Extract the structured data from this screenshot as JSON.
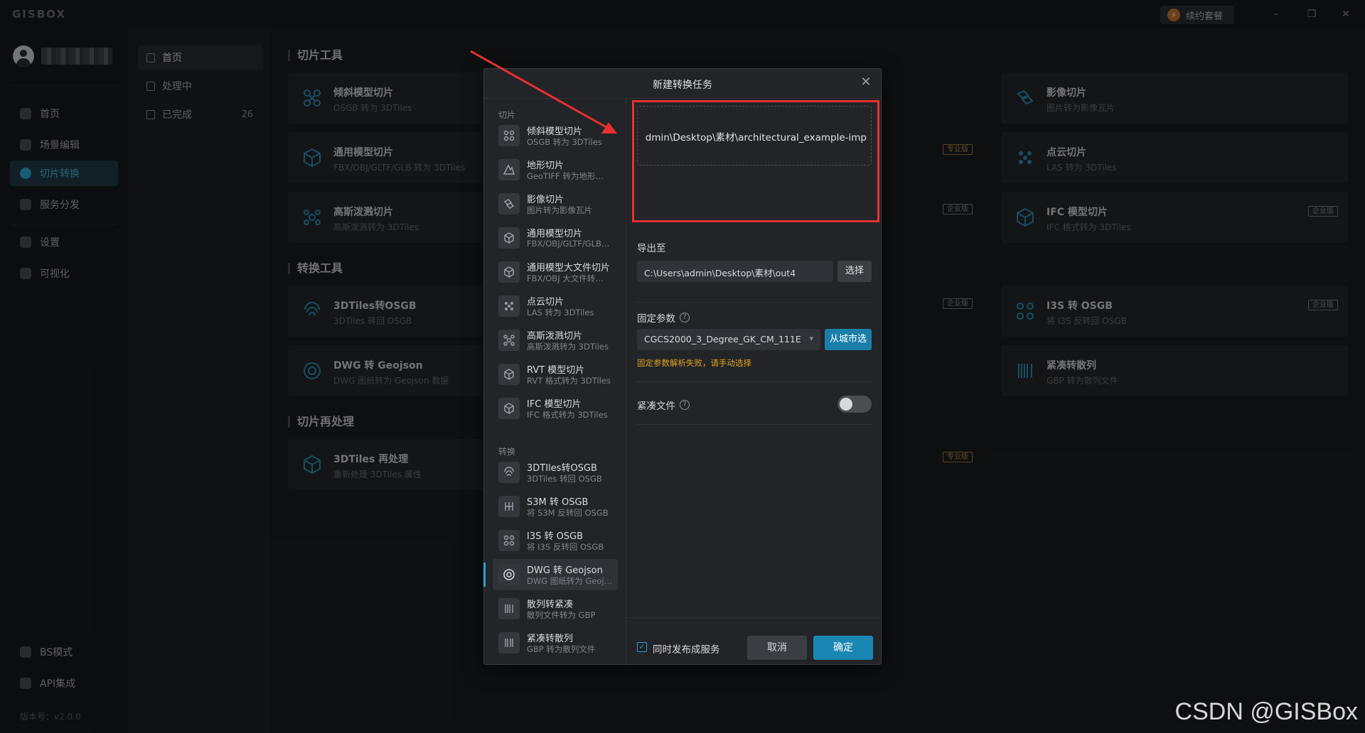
{
  "app": {
    "name": "GISBOX",
    "renew_label": "续约套餐"
  },
  "window_controls": {
    "minimize": "–",
    "restore": "❐",
    "close": "✕"
  },
  "user": {
    "name": ""
  },
  "nav": [
    {
      "label": "首页",
      "icon": "home-icon"
    },
    {
      "label": "场景编辑",
      "icon": "cube-icon"
    },
    {
      "label": "切片转换",
      "icon": "convert-icon",
      "active": true
    },
    {
      "label": "服务分发",
      "icon": "upload-icon"
    },
    {
      "label": "设置",
      "icon": "gear-icon"
    },
    {
      "label": "可视化",
      "icon": "visual-icon"
    }
  ],
  "nav_bottom": [
    {
      "label": "BS模式",
      "icon": "bs-mode-icon"
    },
    {
      "label": "API集成",
      "icon": "api-icon"
    }
  ],
  "version": "版本号：v2.0.0",
  "subnav": [
    {
      "label": "首页",
      "count": ""
    },
    {
      "label": "处理中",
      "count": ""
    },
    {
      "label": "已完成",
      "count": "26"
    }
  ],
  "sections": {
    "slice": "切片工具",
    "convert": "转换工具",
    "reprocess": "切片再处理"
  },
  "cards": [
    {
      "title": "倾斜模型切片",
      "sub": "OSGB 转为 3DTiles",
      "badge": ""
    },
    {
      "title": "影像切片",
      "sub": "图片转为影像瓦片",
      "badge": ""
    },
    {
      "title": "通用模型切片",
      "sub": "FBX/OBJ/GLTF/GLB 转为 3DTiles",
      "badge": ""
    },
    {
      "title": "点云切片",
      "sub": "LAS 转为 3DTiles",
      "badge": ""
    },
    {
      "title": "高斯泼溅切片",
      "sub": "高斯泼溅转为 3DTiles",
      "badge": ""
    },
    {
      "title": "IFC 模型切片",
      "sub": "IFC 格式转为 3DTiles",
      "badge": "企业版"
    },
    {
      "title": "3DTiles转OSGB",
      "sub": "3DTiles 转回 OSGB",
      "badge": ""
    },
    {
      "title": "I3S 转 OSGB",
      "sub": "将 I3S 反转回 OSGB",
      "badge": "企业版"
    },
    {
      "title": "DWG 转 Geojson",
      "sub": "DWG 图纸转为 Geojson 数据",
      "badge": ""
    },
    {
      "title": "紧凑转散列",
      "sub": "GBP 转为散列文件",
      "badge": ""
    },
    {
      "title": "3DTiles 再处理",
      "sub": "重新处理 3DTiles 属性",
      "badge": ""
    }
  ],
  "hidden_badges": [
    "专业版",
    "企业版",
    "企业版",
    "专业版"
  ],
  "dialog": {
    "title": "新建转换任务",
    "close": "✕",
    "group_slice": "切片",
    "group_convert": "转换",
    "tools": [
      {
        "name": "倾斜模型切片",
        "desc": "OSGB 转为 3DTiles",
        "icon": "oblique-model-icon"
      },
      {
        "name": "地形切片",
        "desc": "GeoTIFF 转为地形…",
        "icon": "terrain-icon"
      },
      {
        "name": "影像切片",
        "desc": "图片转为影像瓦片",
        "icon": "imagery-icon"
      },
      {
        "name": "通用模型切片",
        "desc": "FBX/OBJ/GLTF/GLB…",
        "icon": "model-icon"
      },
      {
        "name": "通用模型大文件切片",
        "desc": "FBX/OBJ 大文件转…",
        "icon": "large-model-icon"
      },
      {
        "name": "点云切片",
        "desc": "LAS 转为 3DTiles",
        "icon": "point-cloud-icon"
      },
      {
        "name": "高斯泼溅切片",
        "desc": "高斯泼溅转为 3DTiles",
        "icon": "gaussian-icon"
      },
      {
        "name": "RVT 模型切片",
        "desc": "RVT 格式转为 3DTiles",
        "icon": "rvt-icon"
      },
      {
        "name": "IFC 模型切片",
        "desc": "IFC 格式转为 3DTiles",
        "icon": "ifc-icon"
      }
    ],
    "convert_tools": [
      {
        "name": "3DTIles转OSGB",
        "desc": "3DTiles 转回 OSGB",
        "icon": "tiles-to-osgb-icon"
      },
      {
        "name": "S3M 转 OSGB",
        "desc": "将 S3M 反转回 OSGB",
        "icon": "s3m-icon"
      },
      {
        "name": "I3S 转 OSGB",
        "desc": "将 I3S 反转回 OSGB",
        "icon": "i3s-icon"
      },
      {
        "name": "DWG 转 Geojson",
        "desc": "DWG 图纸转为 Geoj…",
        "icon": "dwg-icon",
        "selected": true
      },
      {
        "name": "散列转紧凑",
        "desc": "散列文件转为 GBP",
        "icon": "hash-to-compact-icon"
      },
      {
        "name": "紧凑转散列",
        "desc": "GBP 转为散列文件",
        "icon": "compact-to-hash-icon"
      }
    ],
    "input_path": ",admin\\Desktop\\素材\\architectural_example-imp",
    "export_label": "导出至",
    "export_path": "C:\\Users\\admin\\Desktop\\素材\\out4",
    "choose_button": "选择",
    "fixed_params_label": "固定参数",
    "crs_value": "CGCS2000_3_Degree_GK_CM_111E",
    "city_button": "从城市选",
    "warning": "固定参数解析失败，请手动选择",
    "compact_label": "紧凑文件",
    "compact_enabled": false,
    "publish_label": "同时发布成服务",
    "publish_checked": true,
    "cancel": "取消",
    "ok": "确定"
  },
  "watermark": "CSDN @GISBox",
  "colors": {
    "accent": "#22a5d6",
    "warning": "#e0a422",
    "annotation": "#e8302f"
  }
}
